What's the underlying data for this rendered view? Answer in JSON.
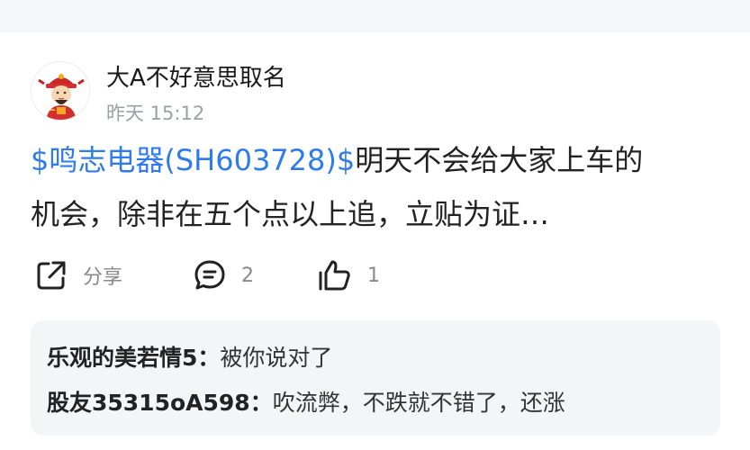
{
  "post": {
    "username": "大A不好意思取名",
    "timestamp": "昨天 15:12",
    "stock_tag": "$鸣志电器(SH603728)$",
    "text_line1_rest": "明天不会给大家上车的",
    "text_line2": "机会，除非在五个点以上追，立贴为证…"
  },
  "actions": {
    "share_label": "分享",
    "comment_count": "2",
    "like_count": "1"
  },
  "comments": [
    {
      "author": "乐观的美若情5：",
      "text": "被你说对了"
    },
    {
      "author": "股友35315oA598：",
      "text": "吹流弊，不跌就不错了，还涨"
    }
  ],
  "icons": {
    "avatar": "caishen-avatar-icon",
    "share": "share-icon",
    "comment": "comment-icon",
    "like": "thumbs-up-icon"
  },
  "colors": {
    "stock_link": "#2f7bea",
    "muted_text": "#9aa0a6",
    "comment_bg": "#f4f5f7"
  }
}
